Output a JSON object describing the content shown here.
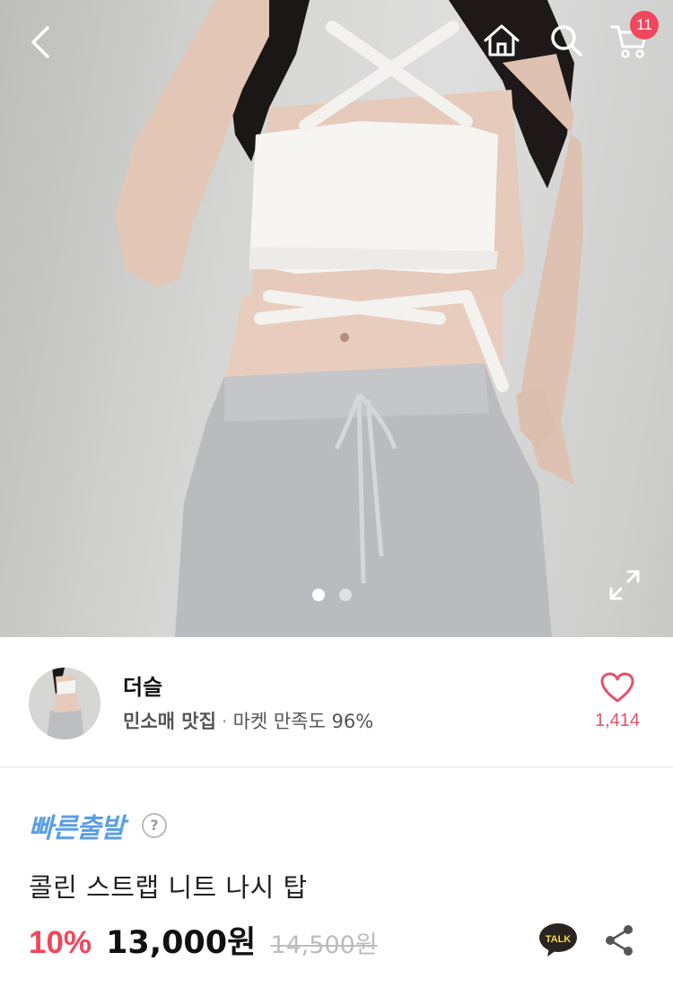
{
  "header": {
    "cart_count": "11",
    "icons": [
      "chevron-left-icon",
      "home-icon",
      "search-icon",
      "cart-icon"
    ]
  },
  "gallery": {
    "total_images": 2,
    "current_index": 1
  },
  "seller": {
    "name": "더슬",
    "tag": "민소매 맛집",
    "separator": "·",
    "satisfaction": "마켓 만족도 96%",
    "likes": "1,414"
  },
  "product": {
    "shipping_badge": "빠른출발",
    "help_symbol": "?",
    "title": "콜린 스트랩 니트 나시 탑",
    "discount": "10%",
    "price": "13,000원",
    "original_price": "14,500원",
    "talk_label": "TALK"
  },
  "colors": {
    "accent_pink": "#f0475d",
    "heart": "#e8506a",
    "fast_badge": "#5b9ee8"
  }
}
